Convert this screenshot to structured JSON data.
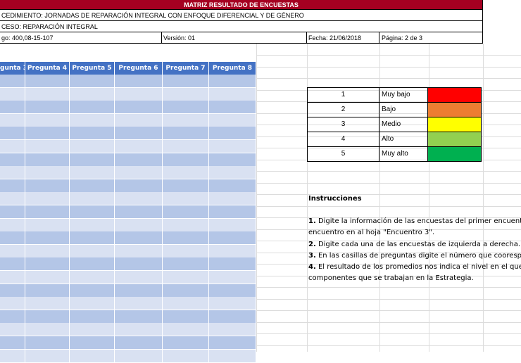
{
  "header": {
    "title": "MATRIZ RESULTADO DE ENCUESTAS",
    "procedimiento": "CEDIMIENTO: JORNADAS DE REPARACIÓN INTEGRAL CON ENFOQUE DIFERENCIAL Y DE GÉNERO",
    "proceso": "CESO: REPARACIÓN INTEGRAL",
    "codigo": "go: 400,08-15-107",
    "version": "Versión: 01",
    "fecha": "Fecha: 21/06/2018",
    "pagina": "Página: 2 de 3"
  },
  "questions": [
    "gunta 3",
    "Pregunta 4",
    "Pregunta 5",
    "Pregunta 6",
    "Pregunta 7",
    "Pregunta 8"
  ],
  "legend": [
    {
      "num": "1",
      "label": "Muy bajo",
      "color": "#ff0000"
    },
    {
      "num": "2",
      "label": "Bajo",
      "color": "#ed7d31"
    },
    {
      "num": "3",
      "label": "Medio",
      "color": "#ffff00"
    },
    {
      "num": "4",
      "label": "Alto",
      "color": "#92d050"
    },
    {
      "num": "5",
      "label": "Muy alto",
      "color": "#00b050"
    }
  ],
  "instructions": {
    "title": "Instrucciones",
    "lines": [
      {
        "num": "1.",
        "text": " Digite la información de las encuestas del primer encuent"
      },
      {
        "num": "",
        "text": "encuentro en al hoja \"Encuentro 3\"."
      },
      {
        "num": "2.",
        "text": " Digite cada una de las encuestas de izquierda a derecha."
      },
      {
        "num": "3.",
        "text": " En las casillas de preguntas digite el número que coorespo"
      },
      {
        "num": "4.",
        "text": " El resultado de los promedios nos indica el nivel en el que"
      },
      {
        "num": "",
        "text": "componentes que se trabajan en la Estrategia."
      }
    ]
  },
  "colors": {
    "title_bg": "#a50021",
    "question_header_bg": "#4472c4",
    "row_light": "#d9e1f2",
    "row_dark": "#b4c6e7"
  }
}
